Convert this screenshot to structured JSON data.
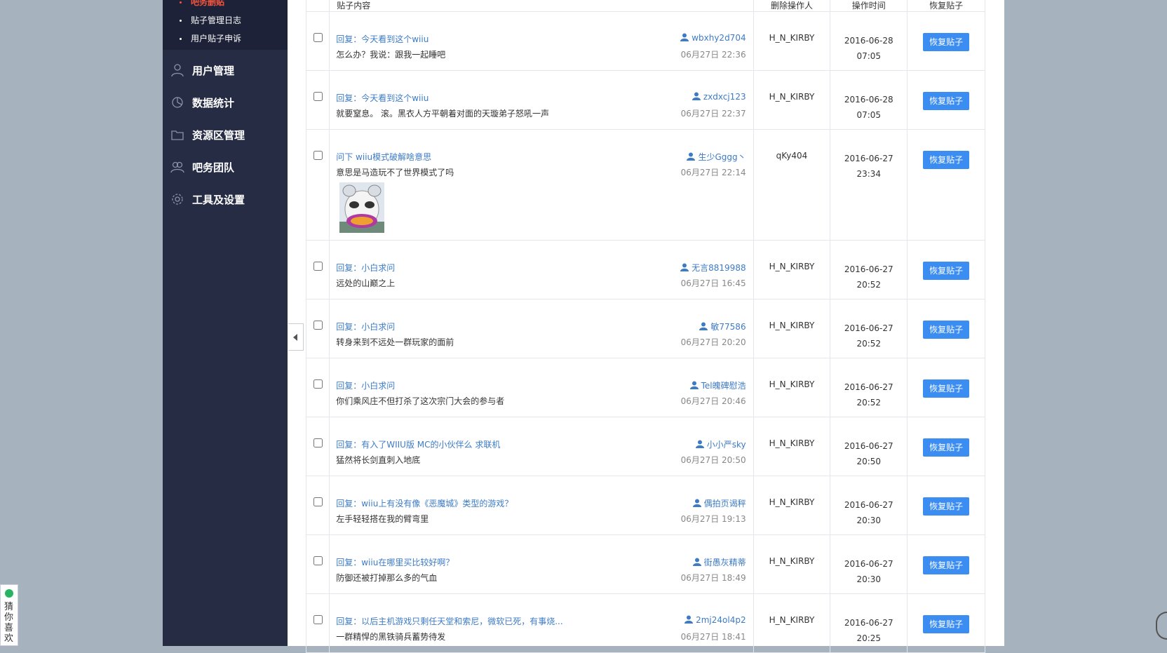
{
  "sidebar": {
    "sub_items": [
      {
        "label": "吧务删贴",
        "active": true
      },
      {
        "label": "贴子管理日志",
        "active": false
      },
      {
        "label": "用户贴子申诉",
        "active": false
      }
    ],
    "nav_items": [
      {
        "label": "用户管理",
        "icon": "user-icon"
      },
      {
        "label": "数据统计",
        "icon": "pie-chart-icon"
      },
      {
        "label": "资源区管理",
        "icon": "folder-icon"
      },
      {
        "label": "吧务团队",
        "icon": "team-icon"
      },
      {
        "label": "工具及设置",
        "icon": "gear-icon"
      }
    ]
  },
  "table": {
    "headers": {
      "post": "贴子内容",
      "operator": "删除操作人",
      "time": "操作时间",
      "action": "恢复贴子"
    },
    "restore_label": "恢复贴子",
    "rows": [
      {
        "title": "回复：今天看到这个wiiu",
        "body": "怎么办？我说：跟我一起睡吧",
        "author": "wbxhy2d704",
        "post_time": "06月27日 22:36",
        "operator": "H_N_KIRBY",
        "date": "2016-06-28",
        "time": "07:05"
      },
      {
        "title": "回复：今天看到这个wiiu",
        "body": "就要窒息。 滚。黑衣人方平朝着对面的天璇弟子怒吼一声",
        "author": "zxdxcj123",
        "post_time": "06月27日 22:37",
        "operator": "H_N_KIRBY",
        "date": "2016-06-28",
        "time": "07:05"
      },
      {
        "title": "问下 wiiu模式破解啥意思",
        "body": "意思是马造玩不了世界模式了吗",
        "author": "生少Gggg丶",
        "post_time": "06月27日 22:14",
        "operator": "qKy404",
        "date": "2016-06-27",
        "time": "23:34"
      },
      {
        "title": "回复：小白求问",
        "body": "远处的山巅之上",
        "author": "无言8819988",
        "post_time": "06月27日 16:45",
        "operator": "H_N_KIRBY",
        "date": "2016-06-27",
        "time": "20:52"
      },
      {
        "title": "回复：小白求问",
        "body": "转身来到不远处一群玩家的面前",
        "author": "敏77586",
        "post_time": "06月27日 20:20",
        "operator": "H_N_KIRBY",
        "date": "2016-06-27",
        "time": "20:52"
      },
      {
        "title": "回复：小白求问",
        "body": "你们乘风庄不但打杀了这次宗门大会的参与者",
        "author": "Tel魄碑慰浩",
        "post_time": "06月27日 20:46",
        "operator": "H_N_KIRBY",
        "date": "2016-06-27",
        "time": "20:52"
      },
      {
        "title": "回复：有入了WIIU版 MC的小伙伴么 求联机",
        "body": "猛然将长剑直刺入地底",
        "author": "小小严sky",
        "post_time": "06月27日 20:50",
        "operator": "H_N_KIRBY",
        "date": "2016-06-27",
        "time": "20:50"
      },
      {
        "title": "回复：wiiu上有没有像《恶魔城》类型的游戏？",
        "body": "左手轻轻搭在我的臂弯里",
        "author": "偶拍页谒秤",
        "post_time": "06月27日 19:13",
        "operator": "H_N_KIRBY",
        "date": "2016-06-27",
        "time": "20:30"
      },
      {
        "title": "回复：wiiu在哪里买比较好啊？",
        "body": "防御还被打掉那么多的气血",
        "author": "街愚灰精蒂",
        "post_time": "06月27日 18:49",
        "operator": "H_N_KIRBY",
        "date": "2016-06-27",
        "time": "20:30"
      },
      {
        "title": "回复：以后主机游戏只剩任天堂和索尼，微软已死，有事烧...",
        "body": "一群精悍的黑铁骑兵蓄势待发",
        "author": "2mj24ol4p2",
        "post_time": "06月27日 18:41",
        "operator": "H_N_KIRBY",
        "date": "2016-06-27",
        "time": "20:25"
      }
    ]
  },
  "widget": {
    "label": "猜你喜欢"
  },
  "colors": {
    "sidebar": "#262c44",
    "accent": "#3b8df2",
    "link": "#3d7bc6",
    "active": "#f5543c"
  }
}
